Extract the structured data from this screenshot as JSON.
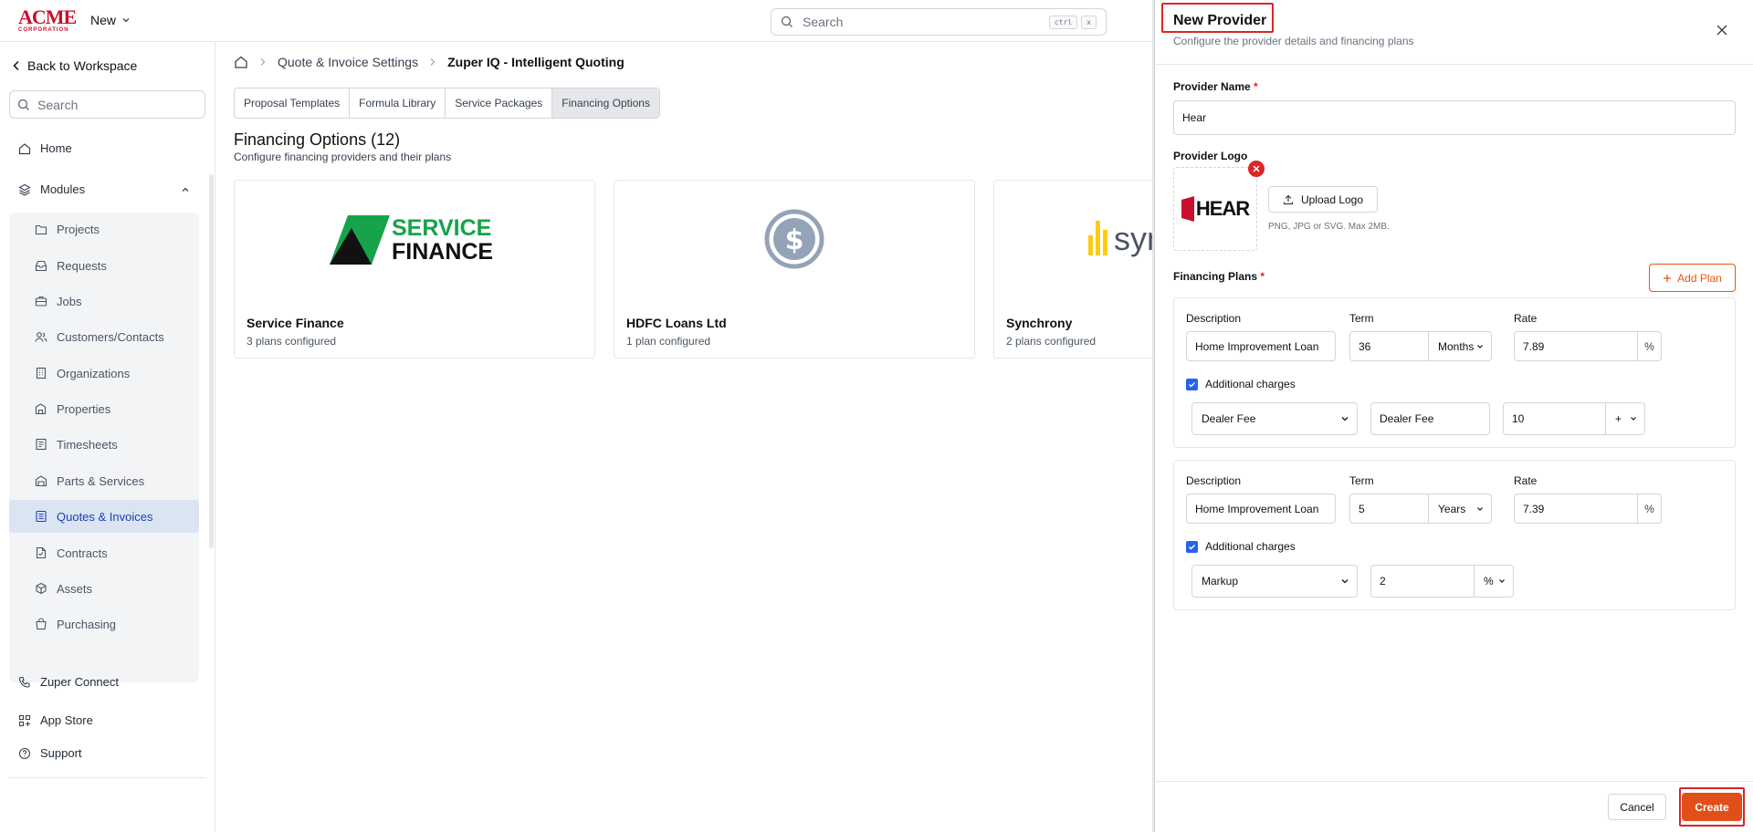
{
  "topbar": {
    "logo_top": "ACME",
    "logo_bottom": "CORPORATION",
    "new_label": "New",
    "search_placeholder": "Search",
    "kbd1": "ctrl",
    "kbd2": "x"
  },
  "sidebar": {
    "back_label": "Back to Workspace",
    "search_placeholder": "Search",
    "home": "Home",
    "modules": "Modules",
    "items": [
      {
        "label": "Projects",
        "icon": "folder-icon"
      },
      {
        "label": "Requests",
        "icon": "inbox-icon"
      },
      {
        "label": "Jobs",
        "icon": "briefcase-icon"
      },
      {
        "label": "Customers/Contacts",
        "icon": "users-icon"
      },
      {
        "label": "Organizations",
        "icon": "building-icon"
      },
      {
        "label": "Properties",
        "icon": "property-icon"
      },
      {
        "label": "Timesheets",
        "icon": "timesheet-icon"
      },
      {
        "label": "Parts & Services",
        "icon": "warehouse-icon"
      },
      {
        "label": "Quotes & Invoices",
        "icon": "invoice-icon"
      },
      {
        "label": "Contracts",
        "icon": "contract-icon"
      },
      {
        "label": "Assets",
        "icon": "cube-icon"
      },
      {
        "label": "Purchasing",
        "icon": "bag-icon"
      }
    ],
    "zuper_connect": "Zuper Connect",
    "app_store": "App Store",
    "support": "Support"
  },
  "main": {
    "breadcrumb": [
      "Quote & Invoice Settings",
      "Zuper IQ - Intelligent Quoting"
    ],
    "tabs": [
      "Proposal Templates",
      "Formula Library",
      "Service Packages",
      "Financing Options"
    ],
    "title": "Financing Options (12)",
    "subtitle": "Configure financing providers and their plans",
    "cards": [
      {
        "name": "Service Finance",
        "sub": "3 plans configured",
        "logo_line1": "SERVICE",
        "logo_line2": "FINANCE"
      },
      {
        "name": "HDFC Loans Ltd",
        "sub": "1 plan configured"
      },
      {
        "name": "Synchrony",
        "sub": "2 plans configured",
        "logo_text": "syn"
      }
    ]
  },
  "panel": {
    "title": "New Provider",
    "subtitle": "Configure the provider details and financing plans",
    "provider_name_label": "Provider Name",
    "provider_name_value": "Hear",
    "provider_logo_label": "Provider Logo",
    "logo_preview_text": "HEAR",
    "upload_label": "Upload Logo",
    "upload_hint": "PNG, JPG or SVG. Max 2MB.",
    "plans_label": "Financing Plans",
    "add_plan_label": "Add Plan",
    "required_mark": "*",
    "plans": [
      {
        "description_label": "Description",
        "term_label": "Term",
        "rate_label": "Rate",
        "description": "Home Improvement Loan",
        "term": "36",
        "term_unit": "Months",
        "rate": "7.89",
        "rate_unit": "%",
        "additional_label": "Additional charges",
        "charge_type": "Dealer Fee",
        "charge_name": "Dealer Fee",
        "charge_value": "10",
        "charge_unit": "+"
      },
      {
        "description_label": "Description",
        "term_label": "Term",
        "rate_label": "Rate",
        "description": "Home Improvement Loan",
        "term": "5",
        "term_unit": "Years",
        "rate": "7.39",
        "rate_unit": "%",
        "additional_label": "Additional charges",
        "charge_type": "Markup",
        "charge_value": "2",
        "charge_unit": "%"
      }
    ],
    "cancel_label": "Cancel",
    "create_label": "Create"
  }
}
